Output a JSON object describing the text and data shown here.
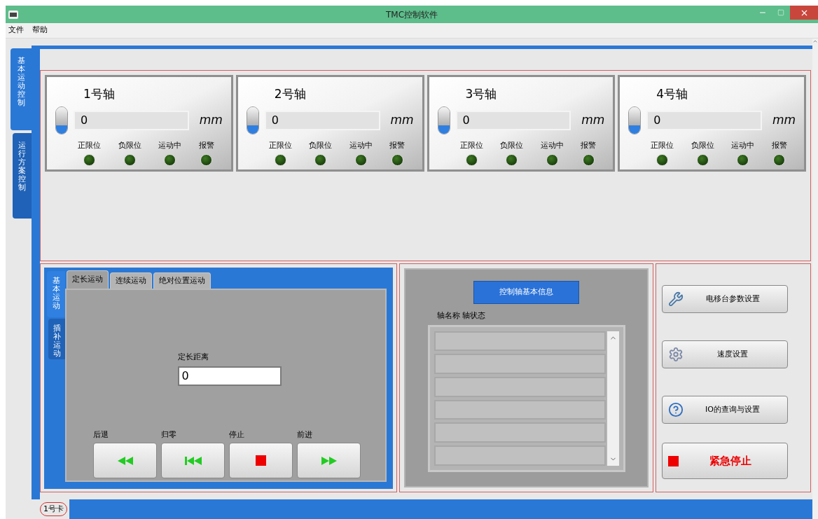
{
  "window": {
    "title": "TMC控制软件"
  },
  "menu": [
    {
      "label": "文件"
    },
    {
      "label": "帮助"
    }
  ],
  "side_tabs": [
    {
      "label": "基本运动控制",
      "selected": true
    },
    {
      "label": "运行方案控制",
      "selected": false
    }
  ],
  "axes": [
    {
      "name": "1号轴",
      "value": "0",
      "unit": "mm",
      "on": false,
      "indicators": [
        {
          "label": "正限位",
          "on": false
        },
        {
          "label": "负限位",
          "on": false
        },
        {
          "label": "运动中",
          "on": false
        },
        {
          "label": "报警",
          "on": false
        }
      ]
    },
    {
      "name": "2号轴",
      "value": "0",
      "unit": "mm",
      "on": false,
      "indicators": [
        {
          "label": "正限位",
          "on": false
        },
        {
          "label": "负限位",
          "on": false
        },
        {
          "label": "运动中",
          "on": false
        },
        {
          "label": "报警",
          "on": false
        }
      ]
    },
    {
      "name": "3号轴",
      "value": "0",
      "unit": "mm",
      "on": false,
      "indicators": [
        {
          "label": "正限位",
          "on": false
        },
        {
          "label": "负限位",
          "on": false
        },
        {
          "label": "运动中",
          "on": false
        },
        {
          "label": "报警",
          "on": false
        }
      ]
    },
    {
      "name": "4号轴",
      "value": "0",
      "unit": "mm",
      "on": false,
      "indicators": [
        {
          "label": "正限位",
          "on": false
        },
        {
          "label": "负限位",
          "on": false
        },
        {
          "label": "运动中",
          "on": false
        },
        {
          "label": "报警",
          "on": false
        }
      ]
    }
  ],
  "motion": {
    "side_tabs": [
      {
        "label": "基本运动",
        "selected": true
      },
      {
        "label": "插补运动",
        "selected": false
      }
    ],
    "tabs": [
      {
        "label": "定长运动",
        "selected": true
      },
      {
        "label": "连续运动",
        "selected": false
      },
      {
        "label": "绝对位置运动",
        "selected": false
      }
    ],
    "distance": {
      "label": "定长距离",
      "value": "0"
    },
    "buttons": [
      {
        "label": "后退",
        "kind": "back"
      },
      {
        "label": "归零",
        "kind": "home"
      },
      {
        "label": "停止",
        "kind": "stop"
      },
      {
        "label": "前进",
        "kind": "forward"
      }
    ]
  },
  "info": {
    "button": "控制轴基本信息",
    "list_header": "轴名称 轴状态"
  },
  "actions": [
    {
      "label": "电移台参数设置",
      "kind": "tools"
    },
    {
      "label": "速度设置",
      "kind": "gear"
    },
    {
      "label": "IO的查询与设置",
      "kind": "help"
    },
    {
      "label": "紧急停止",
      "kind": "stop"
    }
  ],
  "card_tabs": [
    {
      "label": "1号卡",
      "selected": true
    }
  ]
}
